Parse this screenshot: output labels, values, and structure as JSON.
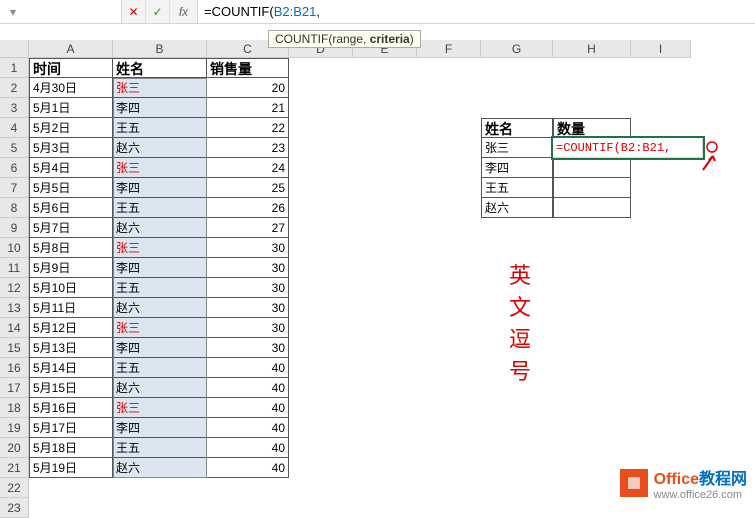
{
  "formula_bar": {
    "name_box": "",
    "fx": "fx",
    "formula_prefix": "=COUNTIF(",
    "formula_ref": "B2:B21",
    "formula_suffix": ",",
    "hint_prefix": "COUNTIF(range, ",
    "hint_bold": "criteria",
    "hint_suffix": ")"
  },
  "columns": [
    "A",
    "B",
    "C",
    "D",
    "E",
    "F",
    "G",
    "H",
    "I"
  ],
  "row_count": 23,
  "headers": {
    "time": "时间",
    "name": "姓名",
    "sales": "销售量"
  },
  "data_rows": [
    {
      "t": "4月30日",
      "n": "张三",
      "s": 20,
      "red": true
    },
    {
      "t": "5月1日",
      "n": "李四",
      "s": 21,
      "red": false
    },
    {
      "t": "5月2日",
      "n": "王五",
      "s": 22,
      "red": false
    },
    {
      "t": "5月3日",
      "n": "赵六",
      "s": 23,
      "red": false
    },
    {
      "t": "5月4日",
      "n": "张三",
      "s": 24,
      "red": true
    },
    {
      "t": "5月5日",
      "n": "李四",
      "s": 25,
      "red": false
    },
    {
      "t": "5月6日",
      "n": "王五",
      "s": 26,
      "red": false
    },
    {
      "t": "5月7日",
      "n": "赵六",
      "s": 27,
      "red": false
    },
    {
      "t": "5月8日",
      "n": "张三",
      "s": 30,
      "red": true
    },
    {
      "t": "5月9日",
      "n": "李四",
      "s": 30,
      "red": false
    },
    {
      "t": "5月10日",
      "n": "王五",
      "s": 30,
      "red": false
    },
    {
      "t": "5月11日",
      "n": "赵六",
      "s": 30,
      "red": false
    },
    {
      "t": "5月12日",
      "n": "张三",
      "s": 30,
      "red": true
    },
    {
      "t": "5月13日",
      "n": "李四",
      "s": 30,
      "red": false
    },
    {
      "t": "5月14日",
      "n": "王五",
      "s": 40,
      "red": false
    },
    {
      "t": "5月15日",
      "n": "赵六",
      "s": 40,
      "red": false
    },
    {
      "t": "5月16日",
      "n": "张三",
      "s": 40,
      "red": true
    },
    {
      "t": "5月17日",
      "n": "李四",
      "s": 40,
      "red": false
    },
    {
      "t": "5月18日",
      "n": "王五",
      "s": 40,
      "red": false
    },
    {
      "t": "5月19日",
      "n": "赵六",
      "s": 40,
      "red": false
    }
  ],
  "summary": {
    "hdr_name": "姓名",
    "hdr_qty": "数量",
    "rows": [
      "张三",
      "李四",
      "王五",
      "赵六"
    ],
    "editing_formula": "=COUNTIF(B2:B21,"
  },
  "annotation": "英文逗号",
  "logo": {
    "brand1": "Office",
    "brand2": "教程网",
    "url": "www.office26.com"
  }
}
